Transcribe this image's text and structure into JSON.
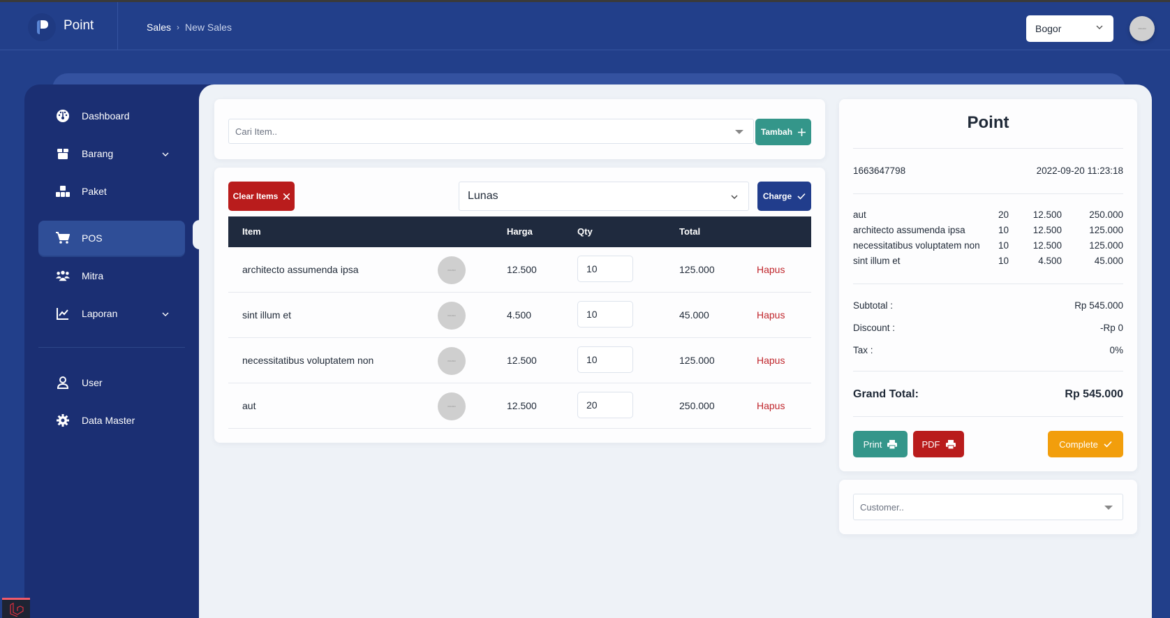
{
  "app": {
    "name": "Point",
    "logo_icon": "p-logo-icon"
  },
  "breadcrumb": {
    "items": [
      "Sales",
      "New Sales"
    ]
  },
  "header": {
    "branch_select": {
      "value": "Bogor"
    },
    "avatar_text": "200x200"
  },
  "sidebar": {
    "items": [
      {
        "label": "Dashboard",
        "icon": "gauge-icon",
        "expandable": false,
        "active": false
      },
      {
        "label": "Barang",
        "icon": "box-icon",
        "expandable": true,
        "active": false
      },
      {
        "label": "Paket",
        "icon": "boxes-icon",
        "expandable": false,
        "active": false
      },
      {
        "label": "POS",
        "icon": "cart-icon",
        "expandable": false,
        "active": true
      },
      {
        "label": "Mitra",
        "icon": "users-icon",
        "expandable": false,
        "active": false
      },
      {
        "label": "Laporan",
        "icon": "chart-line-icon",
        "expandable": true,
        "active": false
      }
    ],
    "bottom_items": [
      {
        "label": "User",
        "icon": "user-icon"
      },
      {
        "label": "Data Master",
        "icon": "gear-icon"
      }
    ]
  },
  "search": {
    "placeholder": "Cari Item..",
    "add_button": "Tambah"
  },
  "cart": {
    "clear_button": "Clear Items",
    "payment_status": "Lunas",
    "charge_button": "Charge",
    "columns": [
      "Item",
      "Harga",
      "Qty",
      "Total"
    ],
    "thumb_text": "800x800",
    "delete_label": "Hapus",
    "rows": [
      {
        "item": "architecto assumenda ipsa",
        "harga": "12.500",
        "qty": "10",
        "total": "125.000"
      },
      {
        "item": "sint illum et",
        "harga": "4.500",
        "qty": "10",
        "total": "45.000"
      },
      {
        "item": "necessitatibus voluptatem non",
        "harga": "12.500",
        "qty": "10",
        "total": "125.000"
      },
      {
        "item": "aut",
        "harga": "12.500",
        "qty": "20",
        "total": "250.000"
      }
    ]
  },
  "receipt": {
    "title": "Point",
    "invoice_no": "1663647798",
    "datetime": "2022-09-20 11:23:18",
    "lines": [
      {
        "item": "aut",
        "qty": "20",
        "price": "12.500",
        "total": "250.000"
      },
      {
        "item": "architecto assumenda ipsa",
        "qty": "10",
        "price": "12.500",
        "total": "125.000"
      },
      {
        "item": "necessitatibus voluptatem non",
        "qty": "10",
        "price": "12.500",
        "total": "125.000"
      },
      {
        "item": "sint illum et",
        "qty": "10",
        "price": "4.500",
        "total": "45.000"
      }
    ],
    "subtotal_label": "Subtotal :",
    "subtotal": "Rp 545.000",
    "discount_label": "Discount :",
    "discount": "-Rp 0",
    "tax_label": "Tax :",
    "tax": "0%",
    "grand_total_label": "Grand Total:",
    "grand_total": "Rp 545.000",
    "print_button": "Print",
    "pdf_button": "PDF",
    "complete_button": "Complete"
  },
  "customer": {
    "placeholder": "Customer.."
  },
  "colors": {
    "header_bg": "#223f8a",
    "sidebar_bg": "#1b2f73",
    "active_item": "#2f4e97",
    "teal": "#34968a",
    "red": "#b91c1c",
    "navy": "#213d8c",
    "amber": "#f29e0c",
    "table_head": "#1f2a3e"
  }
}
